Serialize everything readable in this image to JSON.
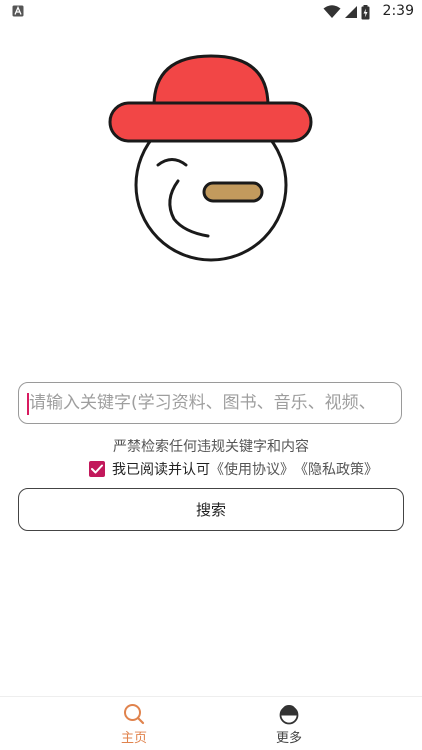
{
  "status_bar": {
    "time": "2:39",
    "icons": [
      "text-notification-icon",
      "wifi-icon",
      "signal-icon",
      "battery-icon"
    ]
  },
  "search": {
    "placeholder": "请输入关键字(学习资料、图书、音乐、视频、",
    "notice": "严禁检索任何违规关键字和内容",
    "agree_text": "我已阅读并认可",
    "agreement_link": "《使用协议》",
    "privacy_link": "《隐私政策》",
    "button_label": "搜索"
  },
  "colors": {
    "hat": "#f24646",
    "nose": "#c29a5d",
    "checkbox": "#c2185b",
    "nav_active": "#e0834d"
  },
  "bottom_nav": {
    "items": [
      {
        "label": "主页",
        "icon": "search-icon",
        "active": true
      },
      {
        "label": "更多",
        "icon": "mascot-icon",
        "active": false
      }
    ]
  }
}
